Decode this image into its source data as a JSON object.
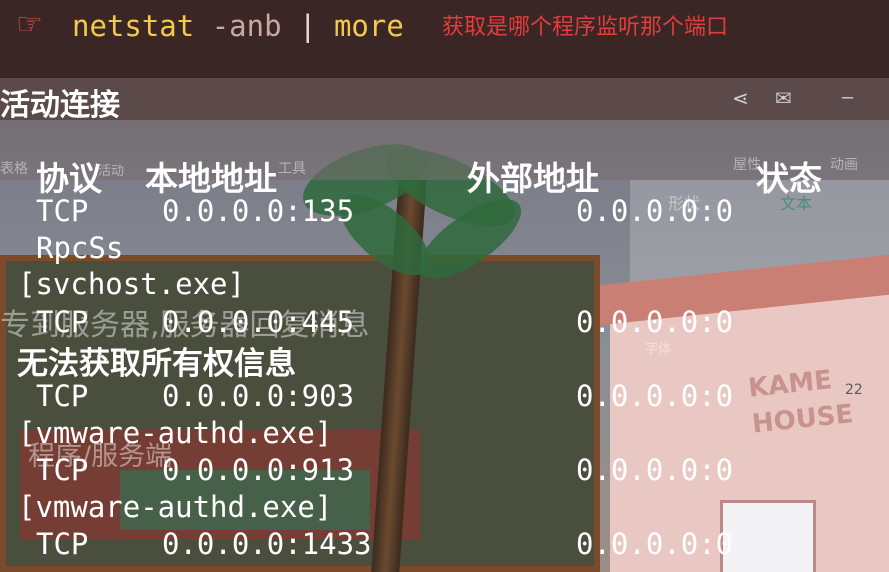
{
  "command": {
    "parts": [
      "netstat",
      "-anb",
      "|",
      "more"
    ],
    "annotation": "获取是哪个程序监听那个端口"
  },
  "background_text": {
    "ribbon": [
      "表格",
      "活动",
      "工具",
      "屋性",
      "动画"
    ],
    "format_tabs": [
      "形状",
      "文本"
    ],
    "font_label": "字体",
    "font_size": "22",
    "ghost_lines": [
      "专到服务器,服务器回复消息",
      "程序/服务端"
    ],
    "sign": "KAME HOUSE"
  },
  "output": {
    "heading": "活动连接",
    "columns": [
      "协议",
      "本地地址",
      "外部地址",
      "状态"
    ],
    "rows": [
      {
        "proto": "TCP",
        "local": "0.0.0.0:135",
        "foreign": "0.0.0.0:0"
      },
      {
        "proto": "TCP",
        "local": "0.0.0.0:445",
        "foreign": "0.0.0.0:0"
      },
      {
        "proto": "TCP",
        "local": "0.0.0.0:903",
        "foreign": "0.0.0.0:0"
      },
      {
        "proto": "TCP",
        "local": "0.0.0.0:913",
        "foreign": "0.0.0.0:0"
      },
      {
        "proto": "TCP",
        "local": "0.0.0.0:1433",
        "foreign": "0.0.0.0:0"
      }
    ],
    "service_rpcss": "RpcSs",
    "exe_svchost": "[svchost.exe]",
    "warning": "无法获取所有权信息",
    "exe_vmware1": "[vmware-authd.exe]",
    "exe_vmware2": "[vmware-authd.exe]"
  },
  "colors": {
    "command": "#f2c94c",
    "annotation": "#e43c3c",
    "prompt_icon": "#e2564c"
  },
  "icons": [
    "hand-pointing-icon",
    "share-icon",
    "mail-icon",
    "minimize-icon"
  ]
}
